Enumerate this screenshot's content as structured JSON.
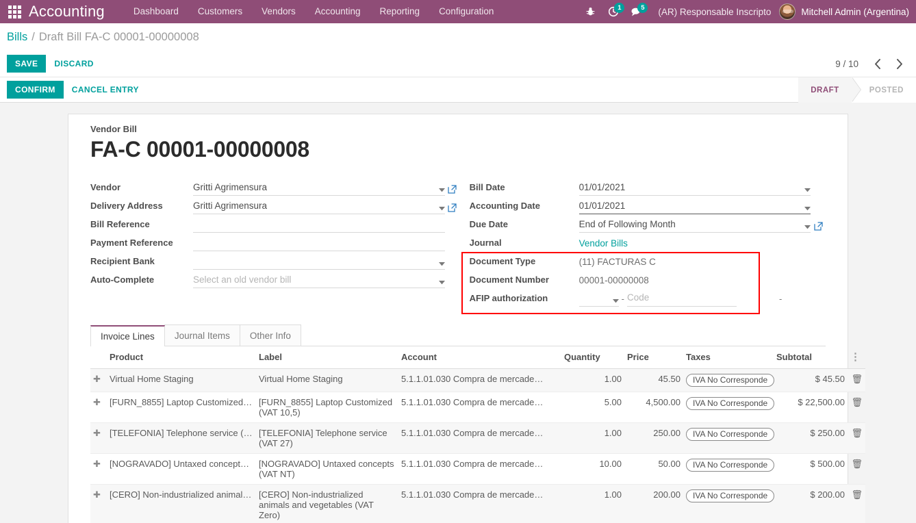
{
  "navbar": {
    "apps_icon": "apps-grid-icon",
    "brand": "Accounting",
    "menu": [
      {
        "label": "Dashboard"
      },
      {
        "label": "Customers"
      },
      {
        "label": "Vendors"
      },
      {
        "label": "Accounting"
      },
      {
        "label": "Reporting"
      },
      {
        "label": "Configuration"
      }
    ],
    "debug_icon": "bug-icon",
    "activity_icon": "clock-icon",
    "activity_count": "1",
    "messages_icon": "chat-icon",
    "messages_count": "5",
    "company": "(AR) Responsable Inscripto",
    "avatar_icon": "user-avatar",
    "user": "Mitchell Admin (Argentina)",
    "brand_color": "#8f4d77",
    "accent_color": "#00a09d"
  },
  "breadcrumb": {
    "root": "Bills",
    "separator": "/",
    "current": "Draft Bill FA-C 00001-00000008"
  },
  "controls": {
    "save_label": "SAVE",
    "discard_label": "DISCARD",
    "pager": "9 / 10",
    "prev_icon": "chevron-left-icon",
    "next_icon": "chevron-right-icon"
  },
  "actions": {
    "confirm_label": "CONFIRM",
    "cancel_entry_label": "CANCEL ENTRY",
    "statuses": [
      {
        "label": "DRAFT",
        "active": true
      },
      {
        "label": "POSTED",
        "active": false
      }
    ]
  },
  "form": {
    "sheet_label": "Vendor Bill",
    "title": "FA-C 00001-00000008",
    "left": [
      {
        "label": "Vendor",
        "value": "Gritti Agrimensura",
        "placeholder": "",
        "has_caret": true,
        "has_ext": true
      },
      {
        "label": "Delivery Address",
        "value": "Gritti Agrimensura",
        "placeholder": "",
        "has_caret": true,
        "has_ext": true
      },
      {
        "label": "Bill Reference",
        "value": "",
        "placeholder": "",
        "has_caret": false,
        "has_ext": false
      },
      {
        "label": "Payment Reference",
        "value": "",
        "placeholder": "",
        "has_caret": false,
        "has_ext": false
      },
      {
        "label": "Recipient Bank",
        "value": "",
        "placeholder": "",
        "has_caret": true,
        "has_ext": false
      },
      {
        "label": "Auto-Complete",
        "value": "",
        "placeholder": "Select an old vendor bill",
        "has_caret": true,
        "has_ext": false
      }
    ],
    "right": {
      "bill_date": {
        "label": "Bill Date",
        "value": "01/01/2021"
      },
      "accounting_date": {
        "label": "Accounting Date",
        "value": "01/01/2021"
      },
      "due_date": {
        "label": "Due Date",
        "value": "End of Following Month"
      },
      "journal": {
        "label": "Journal",
        "value": "Vendor Bills"
      },
      "document_type": {
        "label": "Document Type",
        "value": "(11) FACTURAS C"
      },
      "document_number": {
        "label": "Document Number",
        "value": "00001-00000008"
      },
      "afip": {
        "label": "AFIP authorization",
        "select_value": "",
        "dash": "-",
        "code_placeholder": "Code",
        "trailing_dash": "-"
      }
    },
    "highlight_color": "#ff0000"
  },
  "tabs": [
    {
      "label": "Invoice Lines",
      "active": true
    },
    {
      "label": "Journal Items",
      "active": false
    },
    {
      "label": "Other Info",
      "active": false
    }
  ],
  "lines_table": {
    "columns": [
      "Product",
      "Label",
      "Account",
      "Quantity",
      "Price",
      "Taxes",
      "Subtotal"
    ],
    "options_icon": "vertical-dots-icon",
    "rows": [
      {
        "handle_icon": "drag-handle-icon",
        "product": "Virtual Home Staging",
        "label": "Virtual Home Staging",
        "account": "5.1.1.01.030 Compra de mercade…",
        "quantity": "1.00",
        "price": "45.50",
        "tax": "IVA No Corresponde",
        "subtotal": "$ 45.50",
        "delete_icon": "trash-icon"
      },
      {
        "handle_icon": "drag-handle-icon",
        "product": "[FURN_8855] Laptop Customized …",
        "label": "[FURN_8855] Laptop Customized (VAT 10,5)",
        "account": "5.1.1.01.030 Compra de mercade…",
        "quantity": "5.00",
        "price": "4,500.00",
        "tax": "IVA No Corresponde",
        "subtotal": "$ 22,500.00",
        "delete_icon": "trash-icon"
      },
      {
        "handle_icon": "drag-handle-icon",
        "product": "[TELEFONIA] Telephone service (…",
        "label": "[TELEFONIA] Telephone service (VAT 27)",
        "account": "5.1.1.01.030 Compra de mercade…",
        "quantity": "1.00",
        "price": "250.00",
        "tax": "IVA No Corresponde",
        "subtotal": "$ 250.00",
        "delete_icon": "trash-icon"
      },
      {
        "handle_icon": "drag-handle-icon",
        "product": "[NOGRAVADO] Untaxed concepts …",
        "label": "[NOGRAVADO] Untaxed concepts (VAT NT)",
        "account": "5.1.1.01.030 Compra de mercade…",
        "quantity": "10.00",
        "price": "50.00",
        "tax": "IVA No Corresponde",
        "subtotal": "$ 500.00",
        "delete_icon": "trash-icon"
      },
      {
        "handle_icon": "drag-handle-icon",
        "product": "[CERO] Non-industrialized animal…",
        "label": "[CERO] Non-industrialized animals and vegetables (VAT Zero)",
        "account": "5.1.1.01.030 Compra de mercade…",
        "quantity": "1.00",
        "price": "200.00",
        "tax": "IVA No Corresponde",
        "subtotal": "$ 200.00",
        "delete_icon": "trash-icon"
      }
    ]
  }
}
